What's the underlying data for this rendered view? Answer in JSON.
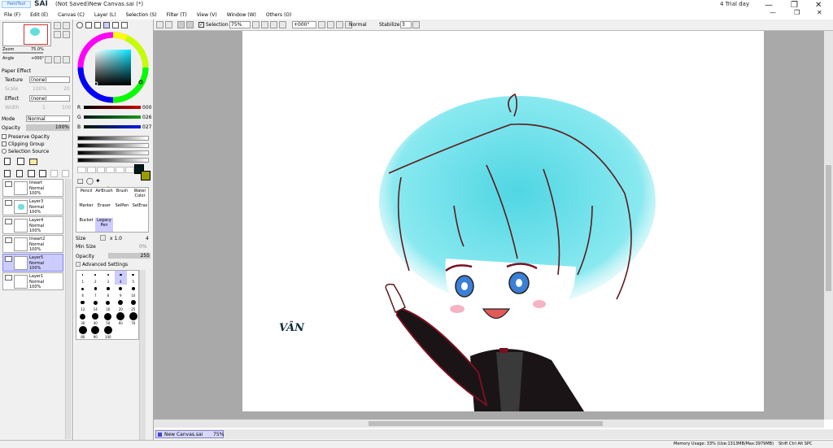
{
  "titlebar": {
    "app_name": "SAI",
    "document_title": "(Not Saved)New Canvas.sai (*)",
    "trial": "4 Trial day"
  },
  "menu": [
    "File (F)",
    "Edit (E)",
    "Canvas (C)",
    "Layer (L)",
    "Selection (S)",
    "Filter (T)",
    "View (V)",
    "Window (W)",
    "Others (O)"
  ],
  "navigator": {
    "zoom_label": "Zoom",
    "zoom_value": "75.0%",
    "angle_label": "Angle",
    "angle_value": "+000°"
  },
  "paper_effect": {
    "header": "Paper Effect",
    "texture_label": "Texture",
    "texture_value": "(none)",
    "scale_label": "Scale",
    "scale_value": "100%",
    "scale_num": "20",
    "effect_label": "Effect",
    "effect_value": "(none)",
    "width_label": "Width",
    "width_value": "1",
    "width_num": "100"
  },
  "layer_props": {
    "mode_label": "Mode",
    "mode_value": "Normal",
    "opacity_label": "Opacity",
    "opacity_value": "100%",
    "preserve_opacity": "Preserve Opacity",
    "clipping_group": "Clipping Group",
    "selection_source": "Selection Source"
  },
  "layers": [
    {
      "name": "lineart",
      "mode": "Normal",
      "opacity": "100%",
      "selected": false
    },
    {
      "name": "Layer3",
      "mode": "Normal",
      "opacity": "100%",
      "selected": false
    },
    {
      "name": "Layer4",
      "mode": "Normal",
      "opacity": "100%",
      "selected": false
    },
    {
      "name": "lineart2",
      "mode": "Normal",
      "opacity": "100%",
      "selected": false
    },
    {
      "name": "Layer5",
      "mode": "Normal",
      "opacity": "100%",
      "selected": true
    },
    {
      "name": "Layer1",
      "mode": "Normal",
      "opacity": "100%",
      "selected": false
    }
  ],
  "color": {
    "r_label": "R",
    "r_value": "000",
    "g_label": "G",
    "g_value": "026",
    "b_label": "B",
    "b_value": "027",
    "current": "#001a1b",
    "secondary": "#9b9b00"
  },
  "tools": [
    {
      "name": "Pencil",
      "row": 0
    },
    {
      "name": "AirBrush",
      "row": 0
    },
    {
      "name": "Brush",
      "row": 0
    },
    {
      "name": "Water Color",
      "row": 0
    },
    {
      "name": "Marker",
      "row": 1
    },
    {
      "name": "Eraser",
      "row": 1
    },
    {
      "name": "SelPen",
      "row": 1
    },
    {
      "name": "SelEras",
      "row": 1
    },
    {
      "name": "Bucket",
      "row": 2
    },
    {
      "name": "Legacy Pen",
      "row": 2
    }
  ],
  "brush": {
    "size_label": "Size",
    "size_mult": "x 1.0",
    "size_value": "4",
    "minsize_label": "Min Size",
    "minsize_value": "0%",
    "opacity_label": "Opacity",
    "opacity_value": "255",
    "advanced": "Advanced Settings"
  },
  "brush_sizes": [
    "1",
    "2",
    "3",
    "4",
    "5",
    "6",
    "7",
    "8",
    "9",
    "10",
    "12",
    "14",
    "16",
    "20",
    "25",
    "30",
    "40",
    "50",
    "60",
    "70",
    "80",
    "90",
    "100"
  ],
  "toolbar": {
    "selection_label": "Selection",
    "zoom_value": "75%",
    "angle_value": "+000°",
    "mode_value": "Normal",
    "stabilizer_label": "Stabilizer",
    "stabilizer_value": "3"
  },
  "canvas": {
    "signature": "VÂN"
  },
  "tab": {
    "name": "New Canvas.sai",
    "zoom": "75%"
  },
  "status": {
    "memory": "Memory Usage: 33% (Use:1313MB/Max:3979MB)",
    "keys": "Shift Ctrl Alt SPC"
  }
}
